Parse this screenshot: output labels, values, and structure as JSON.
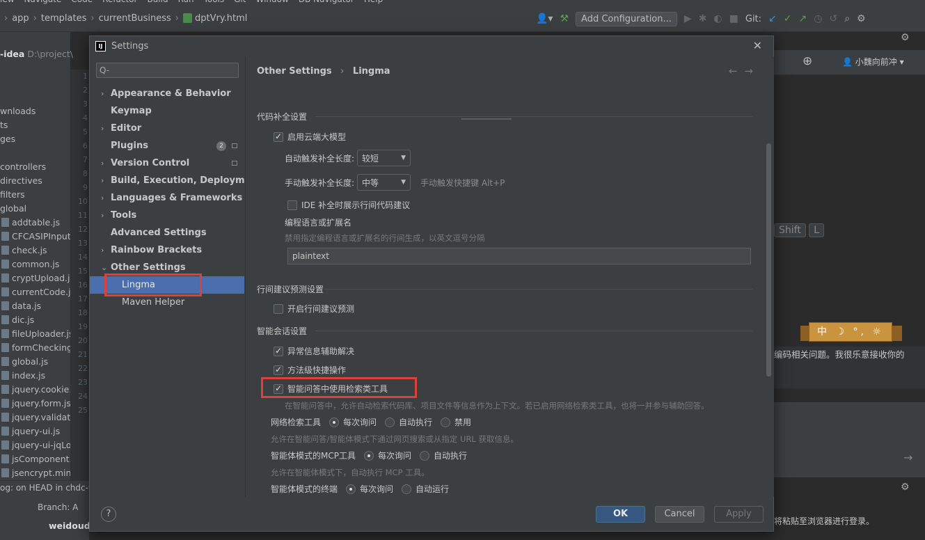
{
  "ide": {
    "menu": [
      "iew",
      "Navigate",
      "Code",
      "Refactor",
      "Build",
      "Run",
      "Tools",
      "Git",
      "Window",
      "DB Navigator",
      "Help"
    ],
    "breadcrumb": [
      "app",
      "templates",
      "currentBusiness",
      "dptVry.html"
    ],
    "add_configuration": "Add Configuration...",
    "git_label": "Git:",
    "project_name": "-idea",
    "project_path": "D:\\project\\",
    "tree_items": [
      {
        "name": "wnloads",
        "js": false
      },
      {
        "name": "ts",
        "js": false
      },
      {
        "name": "ges",
        "js": false
      },
      {
        "name": "",
        "js": false
      },
      {
        "name": "controllers",
        "js": false
      },
      {
        "name": "directives",
        "js": false
      },
      {
        "name": "filters",
        "js": false
      },
      {
        "name": "global",
        "js": false
      },
      {
        "name": "addtable.js",
        "js": true
      },
      {
        "name": "CFCASIPInput.r",
        "js": true
      },
      {
        "name": "check.js",
        "js": true
      },
      {
        "name": "common.js",
        "js": true
      },
      {
        "name": "cryptUpload.js",
        "js": true
      },
      {
        "name": "currentCode.js",
        "js": true
      },
      {
        "name": "data.js",
        "js": true
      },
      {
        "name": "dic.js",
        "js": true
      },
      {
        "name": "fileUploader.js",
        "js": true
      },
      {
        "name": "formChecking.j",
        "js": true
      },
      {
        "name": "global.js",
        "js": true
      },
      {
        "name": "index.js",
        "js": true
      },
      {
        "name": "jquery.cookie.j",
        "js": true
      },
      {
        "name": "jquery.form.js",
        "js": true
      },
      {
        "name": "jquery.validate",
        "js": true
      },
      {
        "name": "jquery-ui.js",
        "js": true
      },
      {
        "name": "jquery-ui-jqLoc",
        "js": true
      },
      {
        "name": "jsComponent.js",
        "js": true
      },
      {
        "name": "jsencrypt.min.js",
        "js": true
      }
    ],
    "line_numbers": [
      "1",
      "2",
      "3",
      "4",
      "5",
      "6",
      "7",
      "8",
      "9",
      "10",
      "11",
      "12",
      "13",
      "14",
      "15",
      "16",
      "17",
      "18",
      "19",
      "20",
      "21",
      "22",
      "23",
      "24",
      "25"
    ],
    "git_log": "og: on HEAD in chdc-w",
    "branch": "Branch: A",
    "bottom_user": "weidoud",
    "right_user": "小魏向前冲",
    "kbd_shift": "Shift",
    "kbd_l": "L",
    "ribbon_text": "中 ☽ °, ☼",
    "chat_message": "编码相关问题。我很乐意接收你的",
    "footer_text": "将粘贴至浏览器进行登录。"
  },
  "dialog": {
    "title": "Settings",
    "search_placeholder": "Q-",
    "nav": [
      {
        "label": "Appearance & Behavior",
        "arrow": "›",
        "child": false
      },
      {
        "label": "Keymap",
        "arrow": "",
        "child": false
      },
      {
        "label": "Editor",
        "arrow": "›",
        "child": false
      },
      {
        "label": "Plugins",
        "arrow": "",
        "child": false,
        "badge": "2"
      },
      {
        "label": "Version Control",
        "arrow": "›",
        "child": false,
        "square": true
      },
      {
        "label": "Build, Execution, Deployment",
        "arrow": "›",
        "child": false
      },
      {
        "label": "Languages & Frameworks",
        "arrow": "›",
        "child": false
      },
      {
        "label": "Tools",
        "arrow": "›",
        "child": false
      },
      {
        "label": "Advanced Settings",
        "arrow": "",
        "child": false
      },
      {
        "label": "Rainbow Brackets",
        "arrow": "›",
        "child": false
      },
      {
        "label": "Other Settings",
        "arrow": "⌄",
        "child": false
      },
      {
        "label": "Lingma",
        "arrow": "",
        "child": true,
        "selected": true
      },
      {
        "label": "Maven Helper",
        "arrow": "",
        "child": true
      }
    ],
    "breadcrumb_parent": "Other Settings",
    "breadcrumb_current": "Lingma",
    "code_completion": {
      "section": "代码补全设置",
      "enable_cloud": "启用云端大模型",
      "auto_length_label": "自动触发补全长度:",
      "auto_length_value": "较短",
      "manual_length_label": "手动触发补全长度:",
      "manual_length_value": "中等",
      "manual_shortcut": "手动触发快捷键 Alt+P",
      "ide_inline": "IDE 补全时展示行间代码建议",
      "lang_label": "编程语言或扩展名",
      "lang_hint": "禁用指定编程语言或扩展名的行间生成，以英文逗号分隔",
      "lang_value": "plaintext"
    },
    "inline": {
      "section": "行间建议预测设置",
      "enable": "开启行间建议预测"
    },
    "chat": {
      "section": "智能会话设置",
      "exception_help": "异常信息辅助解决",
      "method_shortcut": "方法级快捷操作",
      "search_tools": "智能问答中使用检索类工具",
      "search_tools_hint": "在智能问答中，允许自动检索代码库、项目文件等信息作为上下文。若已启用网络检索类工具，也将一并参与辅助回答。",
      "web_search_label": "网络检索工具",
      "web_search_options": [
        "每次询问",
        "自动执行",
        "禁用"
      ],
      "web_search_hint": "允许在智能问答/智能体模式下通过网页搜索或从指定 URL 获取信息。",
      "mcp_label": "智能体模式的MCP工具",
      "mcp_options": [
        "每次询问",
        "自动执行"
      ],
      "mcp_hint": "允许在智能体模式下，自动执行 MCP 工具。",
      "terminal_label": "智能体模式的终端",
      "terminal_options": [
        "每次询问",
        "自动运行"
      ]
    },
    "buttons": {
      "ok": "OK",
      "cancel": "Cancel",
      "apply": "Apply"
    }
  }
}
